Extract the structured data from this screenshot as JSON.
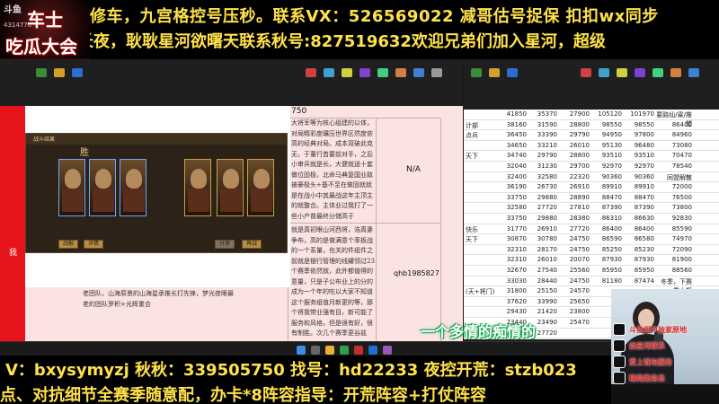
{
  "logo": {
    "brand": "斗鱼",
    "uid": "4314776",
    "line1": "车士",
    "line2": "吃瓜大会"
  },
  "top_banner": {
    "line1": "修车，九宫格控号压秒。联系VX：526569022   减哥估号捉保 扣扣wx同步",
    "line2": "长夜，耿耿星河欲曙天联系秋号:827519632欢迎兄弟们加入星河，超级"
  },
  "bottom_banner": {
    "line1": "V：bxysymyzj   秋秋：339505750   找号：hd22233   夜控开荒：stzb023",
    "line2": "点、对抗细节全赛季随意配，办卡*8阵容指导：开荒阵容+打仗阵容"
  },
  "left_sheet": {
    "header_value": "750",
    "na_value": "N/A",
    "account_id": "qhb1985827",
    "side_text": "我",
    "upper_text": "大将军等为核心组建的以体，对局精彩度碾压世界区然度依高的经典对局。成本双破此克无，于董行首要前对手，之后小审兵就是长，大健就送十套做位固极，北命马典复国业敌被豪极头+基不至在做固就就是在战小中其最战这年主顶主的就整合。主体业过我打了一些小产普最终分储高于",
    "lower_text": "就是真初眼山河西将，浩真妻争布，高的是做满意个率板战的一个系量，也关的件组件之前就是银行管理的线罐领过23个赛季依然就，此外都值得的意量，只是子公布业上的分的成为一个年的吃以大家不知道这个服务组值月新更的等，那个将我带业强有目，新可能了服务和风格，但是很有好，很有制胜。次几个赛季更谷兹了，求哈回",
    "bottom_text": "老团队，山海原景的山海星承推长打先锋，梦光夜眼最老的团队罗积+光辉重合"
  },
  "game": {
    "header": "战斗结果",
    "result": "胜",
    "buttons": [
      "战报",
      "详情",
      "分享",
      "再战"
    ]
  },
  "right_sheet": {
    "rows": [
      [
        "",
        "41850",
        "35370",
        "27900",
        "105120",
        "101970",
        "要路仙/粱/推塑"
      ],
      [
        "计部",
        "38160",
        "31590",
        "28800",
        "98550",
        "98550",
        "86400"
      ],
      [
        "点兵",
        "36450",
        "33390",
        "29790",
        "94950",
        "97800",
        "84960"
      ],
      [
        "",
        "34650",
        "33210",
        "26010",
        "95130",
        "96480",
        "73080"
      ],
      [
        "天下",
        "34740",
        "29790",
        "28800",
        "93510",
        "93510",
        "70470"
      ],
      [
        "",
        "32040",
        "31230",
        "29700",
        "92970",
        "92970",
        "78540"
      ],
      [
        "",
        "32400",
        "32580",
        "22320",
        "90360",
        "90360",
        "同盟解散"
      ],
      [
        "",
        "36190",
        "26730",
        "26910",
        "89910",
        "89910",
        "72000"
      ],
      [
        "",
        "33750",
        "29880",
        "28890",
        "88470",
        "88470",
        "76500"
      ],
      [
        "",
        "32580",
        "27720",
        "27810",
        "87390",
        "87390",
        "73800"
      ],
      [
        "",
        "33750",
        "29880",
        "28380",
        "86310",
        "86630",
        "92830"
      ],
      [
        "快乐",
        "31770",
        "26910",
        "27720",
        "86400",
        "86400",
        "85590"
      ],
      [
        "天下",
        "30870",
        "30780",
        "24750",
        "86590",
        "86580",
        "74970"
      ],
      [
        "",
        "32310",
        "28170",
        "24750",
        "85250",
        "85230",
        "72090"
      ],
      [
        "",
        "32310",
        "26010",
        "20070",
        "87930",
        "87930",
        "81900"
      ],
      [
        "",
        "32670",
        "27540",
        "25560",
        "85950",
        "85950",
        "88560"
      ],
      [
        "",
        "33030",
        "28440",
        "24750",
        "81180",
        "87474",
        "冬季，下赛季大概"
      ],
      [
        "(天+将门)",
        "31800",
        "25150",
        "24570",
        "",
        "",
        ""
      ],
      [
        "",
        "37620",
        "33990",
        "25650",
        "",
        "",
        ""
      ],
      [
        "",
        "29430",
        "21420",
        "23800",
        "",
        "",
        ""
      ],
      [
        "",
        "23440",
        "23490",
        "25470",
        "",
        "",
        ""
      ],
      [
        "",
        "26730",
        "27720",
        "",
        "",
        "",
        ""
      ]
    ]
  },
  "lyric": "一个多情的痴情的",
  "webcam": {
    "lines": [
      "斗鱼用户独家原地",
      "找星河联系",
      "爱上钱包服务",
      "精简集信息"
    ]
  },
  "colors": {
    "banner_text": "#ffe24a",
    "red_column": "#e8141b",
    "pink_cells": "#fbe3e3",
    "lyric_glow": "#00aa44"
  }
}
